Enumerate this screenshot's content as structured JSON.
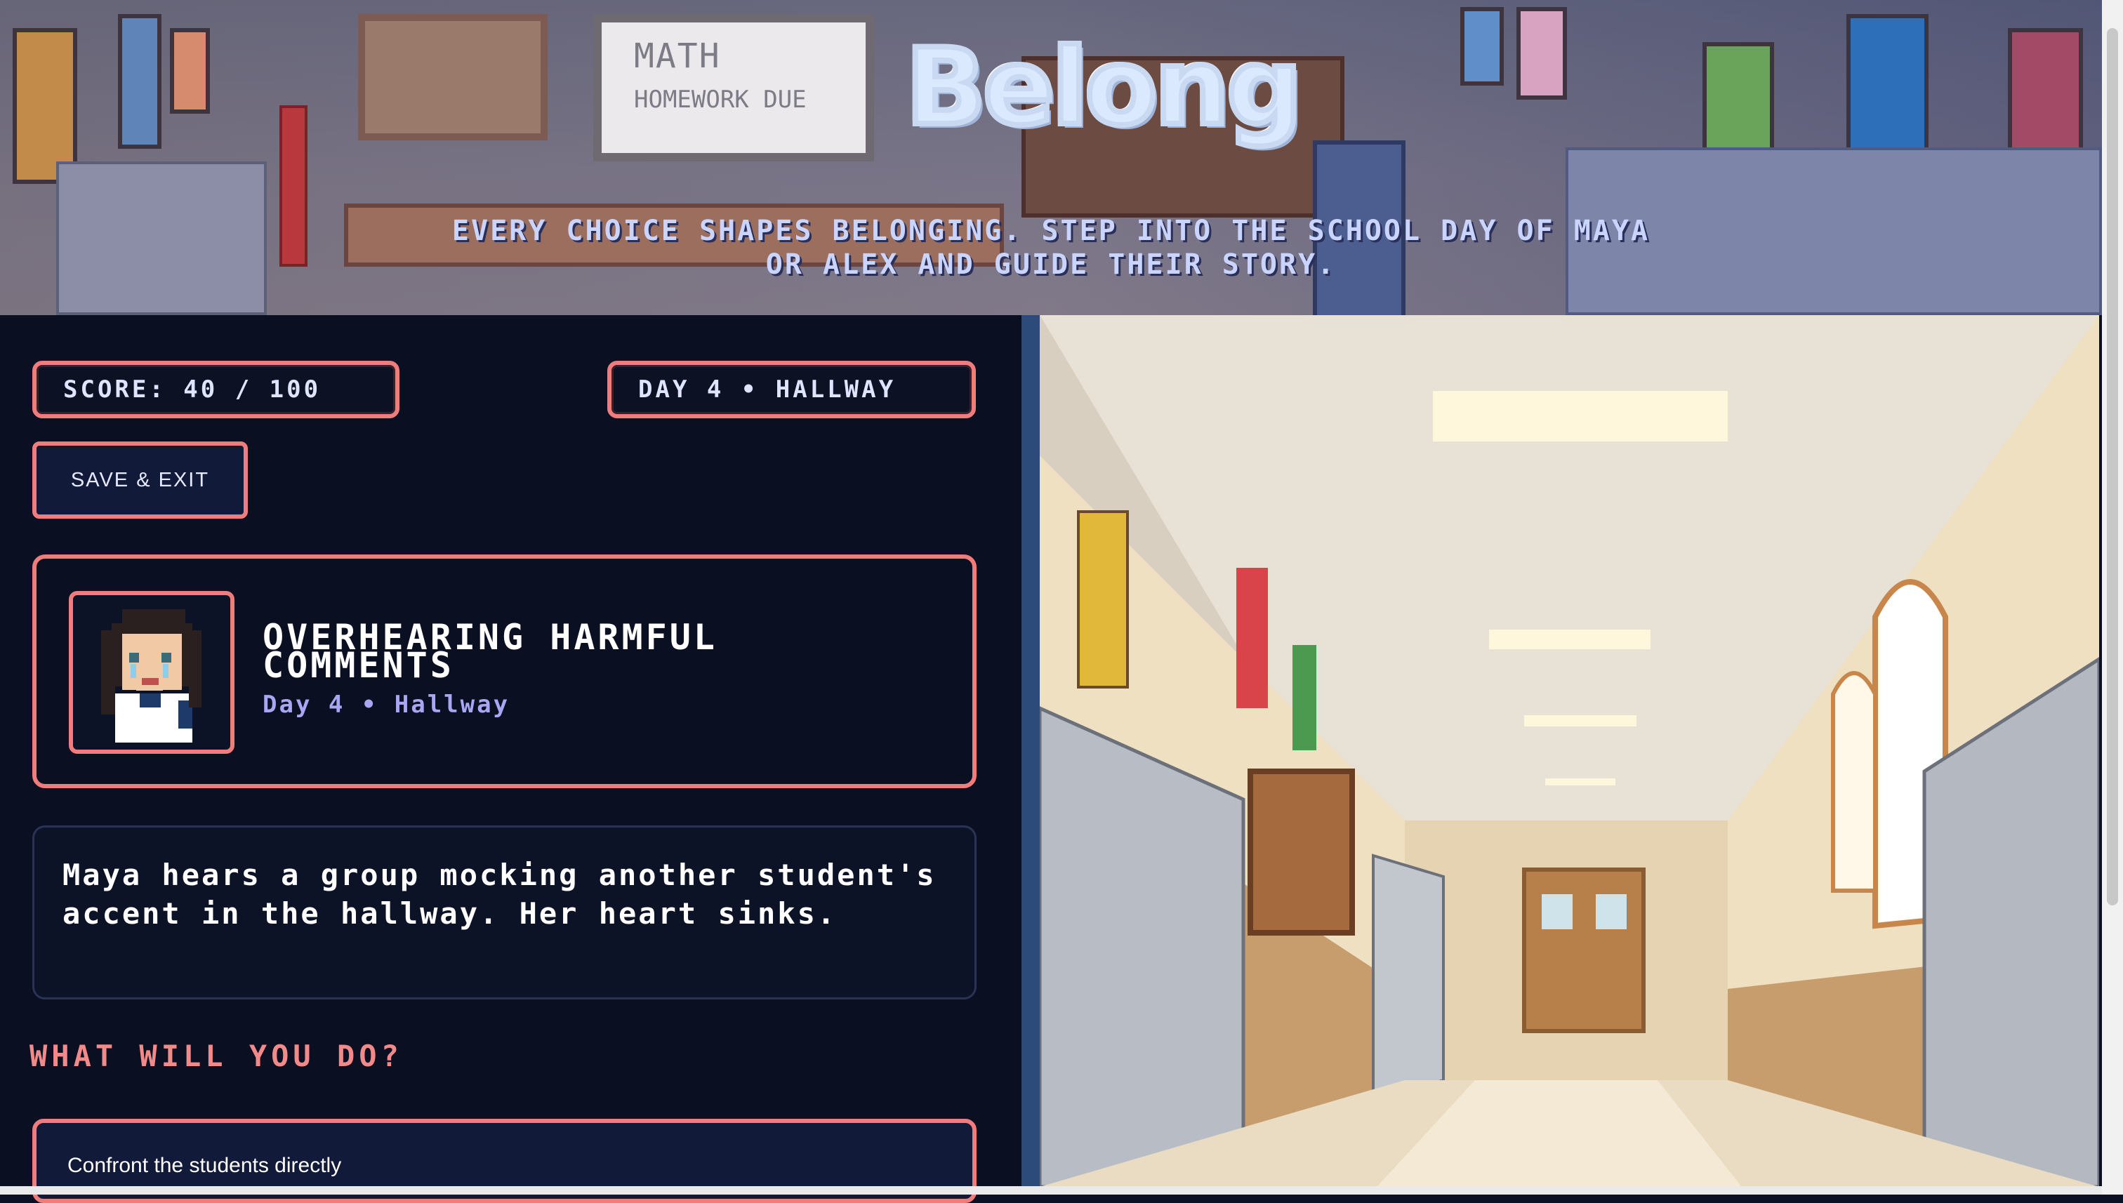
{
  "header": {
    "logo_text": "Belong",
    "tagline": "EVERY CHOICE SHAPES BELONGING. STEP INTO THE SCHOOL DAY OF MAYA OR ALEX AND GUIDE THEIR STORY.",
    "board_line1": "MATH",
    "board_line2": "HOMEWORK DUE"
  },
  "status": {
    "score": "SCORE: 40 / 100",
    "day_location": "DAY 4 • HALLWAY"
  },
  "controls": {
    "save_exit": "SAVE & EXIT"
  },
  "scene_card": {
    "title": "OVERHEARING HARMFUL COMMENTS",
    "subtitle": "Day 4 • Hallway",
    "avatar_icon": "crying-girl-avatar"
  },
  "story": {
    "text": "Maya hears a group mocking another student's accent in the hallway. Her heart sinks."
  },
  "choices": {
    "prompt": "WHAT WILL YOU DO?",
    "items": [
      {
        "label": "Confront the students directly"
      }
    ]
  },
  "colors": {
    "accent": "#f07c7c",
    "panel_bg": "#0a0f21",
    "subtitle": "#a9a6f4",
    "divider": "#2c4a7a"
  }
}
